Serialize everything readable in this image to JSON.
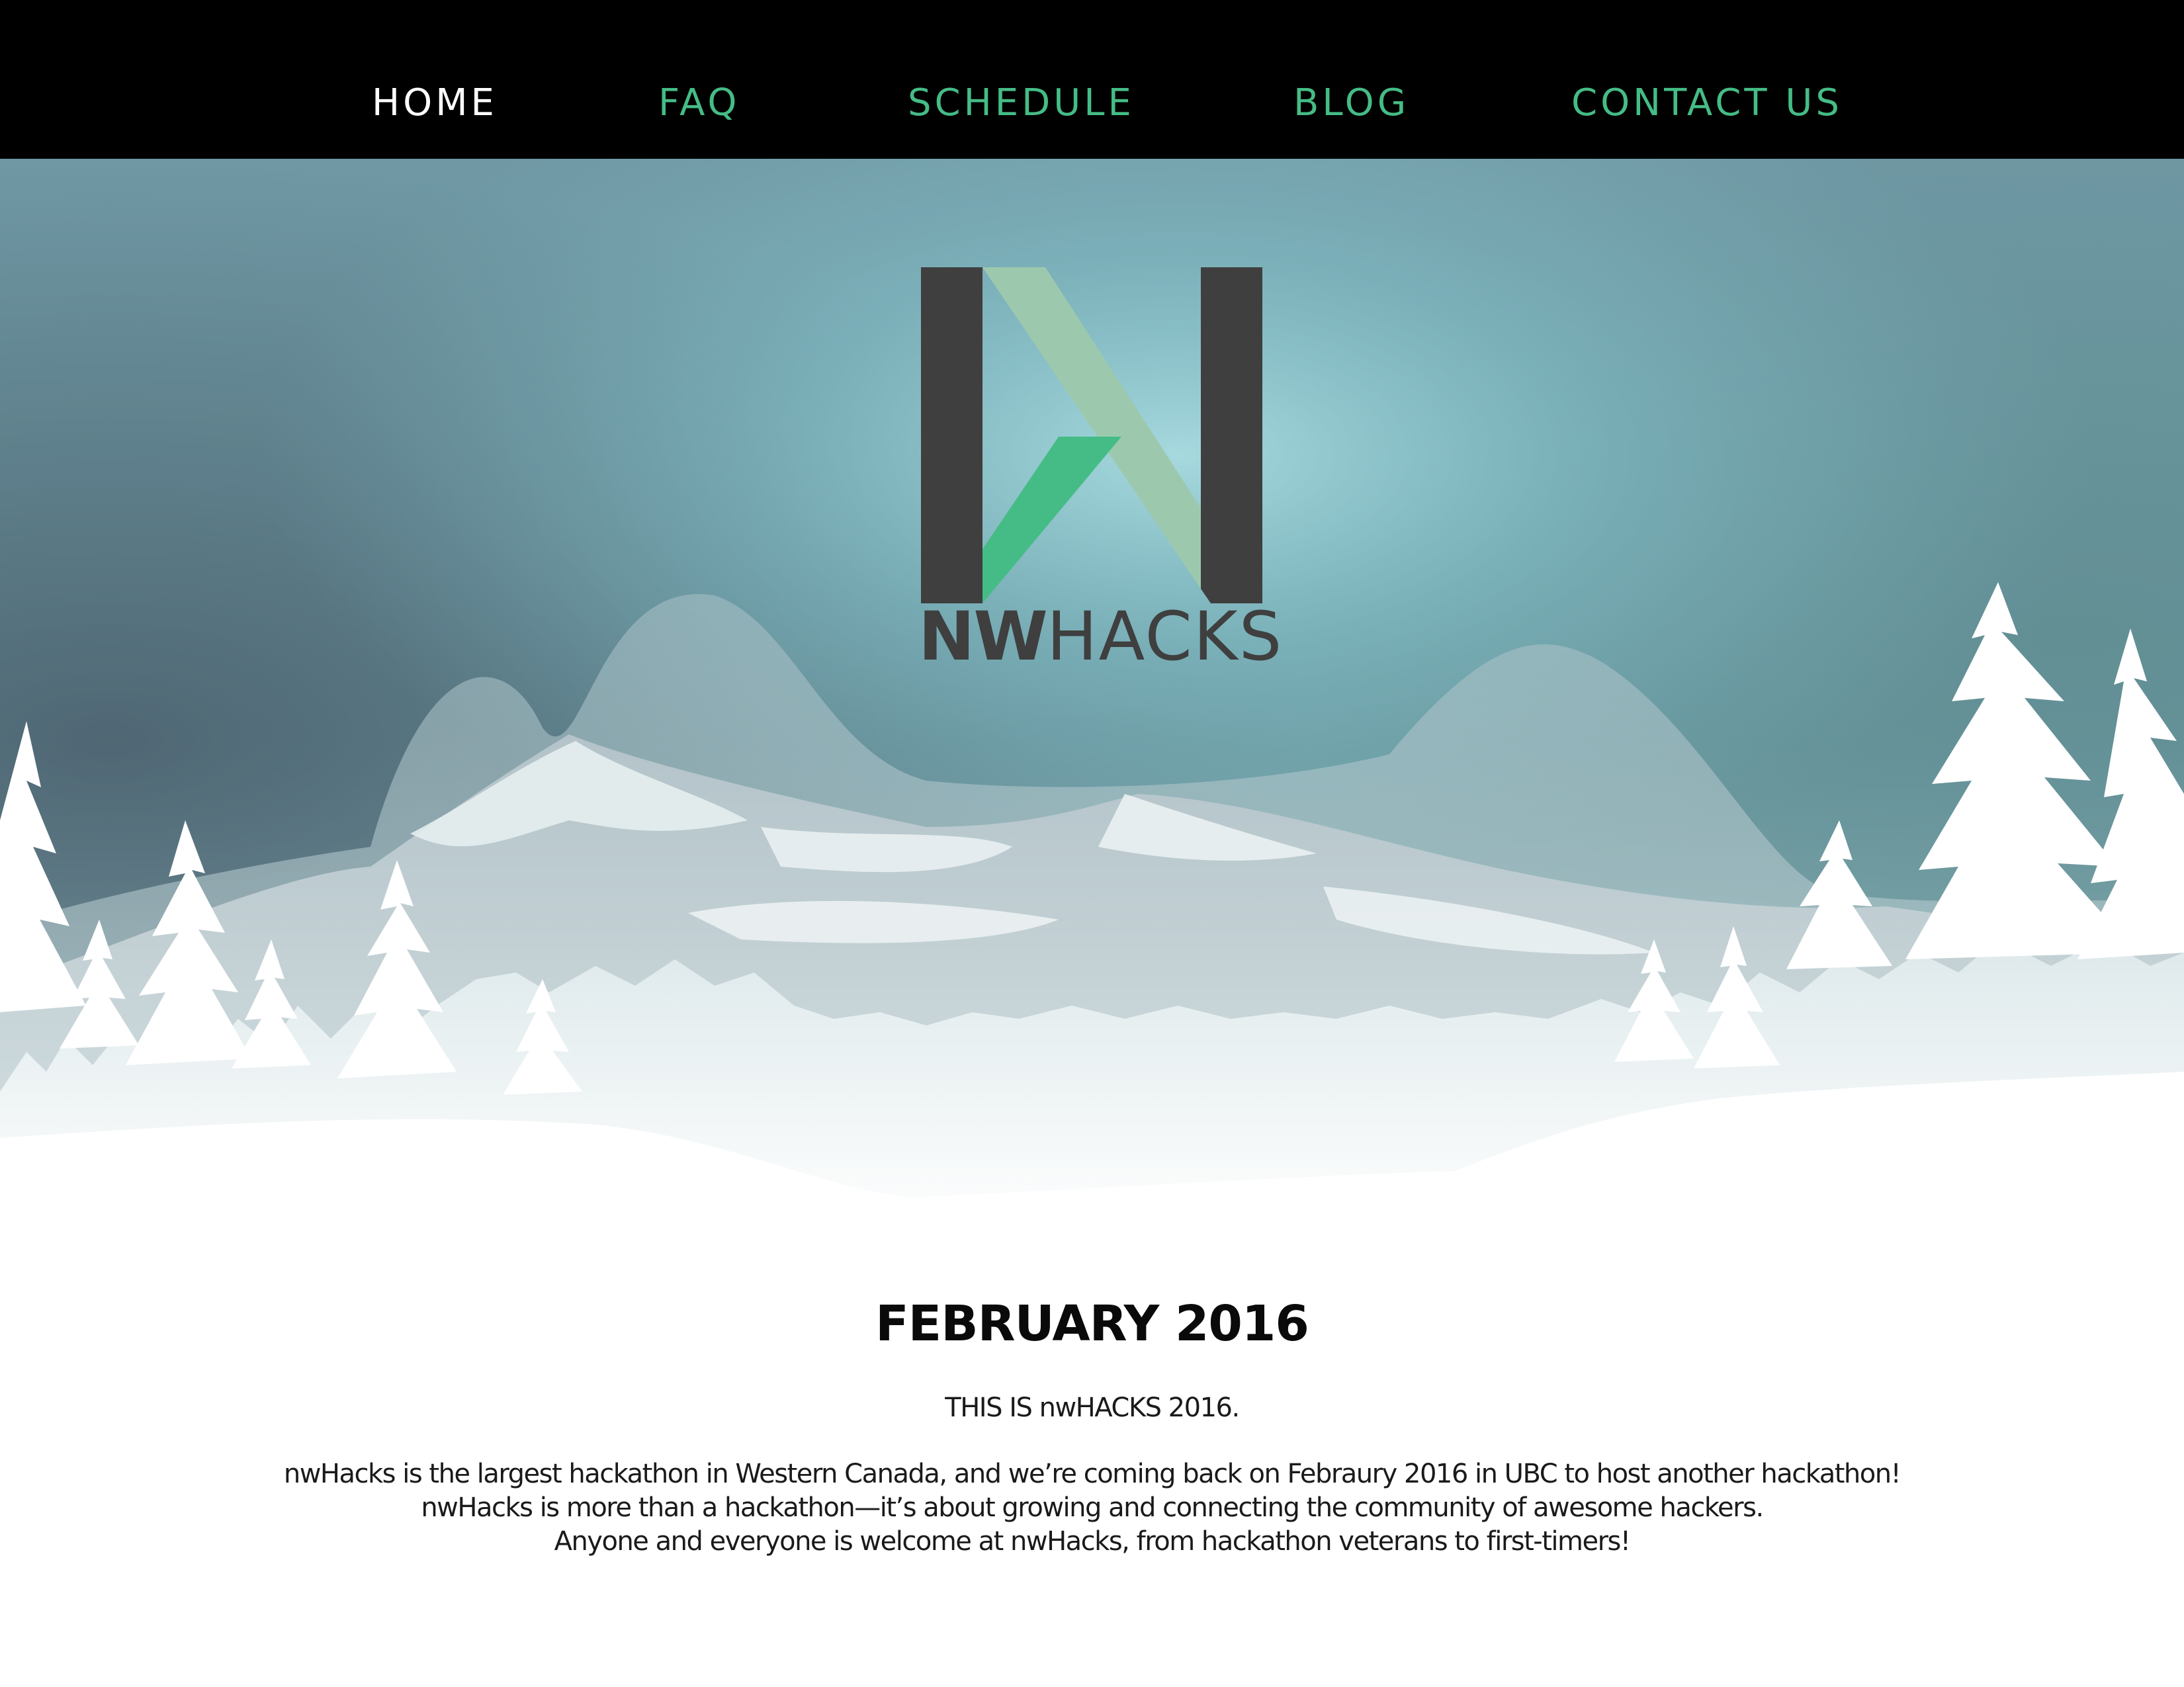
{
  "nav": {
    "items": [
      {
        "label": "HOME",
        "active": true
      },
      {
        "label": "FAQ",
        "active": false
      },
      {
        "label": "SCHEDULE",
        "active": false
      },
      {
        "label": "BLOG",
        "active": false
      },
      {
        "label": "CONTACT US",
        "active": false
      }
    ]
  },
  "hero": {
    "logo_text_bold": "NW",
    "logo_text_light": "HACKS",
    "logo_icon": "nwhacks-n-logo-icon"
  },
  "main": {
    "headline": "FEBRUARY 2016",
    "subhead": "THIS IS nwHACKS 2016.",
    "paragraph_lines": [
      "nwHacks is the largest hackathon in Western Canada, and we’re coming back on Febraury 2016 in UBC to host another hackathon!",
      "nwHacks is more than a hackathon—it’s about growing and connecting the community of awesome hackers.",
      "Anyone and everyone is welcome at nwHacks, from hackathon veterans to first-timers!"
    ]
  },
  "colors": {
    "nav_background": "#000000",
    "nav_active": "#ffffff",
    "nav_link": "#45bc86",
    "logo_dark": "#3f3f3f",
    "logo_green": "#45bc86",
    "logo_light_green": "#9cc9ae"
  }
}
